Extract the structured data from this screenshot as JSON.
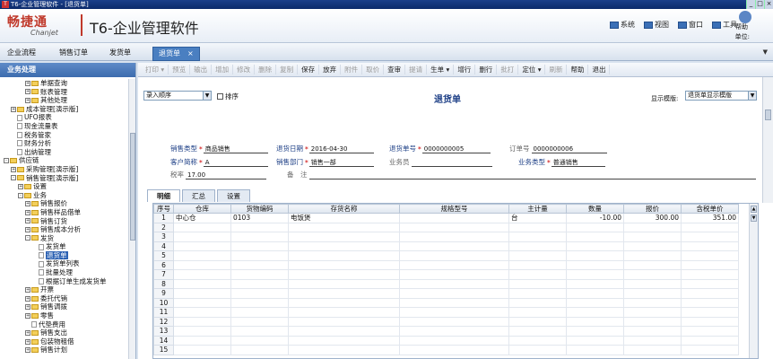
{
  "window": {
    "title": "T6-企业管理软件 - [退货单]",
    "logo_cn": "畅捷通",
    "logo_en": "Chanjet",
    "product": "T6-企业管理软件",
    "menu": [
      {
        "label": "系统",
        "icon": "monitor-icon"
      },
      {
        "label": "视图",
        "icon": "grid-icon"
      },
      {
        "label": "窗口",
        "icon": "window-icon"
      },
      {
        "label": "工具",
        "icon": "wrench-icon"
      }
    ],
    "help": "帮助",
    "position": "单位:"
  },
  "tabs": [
    {
      "label": "企业流程"
    },
    {
      "label": "销售订单"
    },
    {
      "label": "发货单"
    },
    {
      "label": "退货单",
      "active": true
    }
  ],
  "tab_close": "×",
  "sidebar": {
    "title": "业务处理",
    "tree": [
      {
        "label": "单据查询",
        "level": 3,
        "type": "folder",
        "pm": "+"
      },
      {
        "label": "账表管理",
        "level": 3,
        "type": "folder",
        "pm": "+"
      },
      {
        "label": "其他处理",
        "level": 3,
        "type": "folder",
        "pm": "+"
      },
      {
        "label": "成本管理[演示版]",
        "level": 1,
        "type": "folder",
        "pm": "+"
      },
      {
        "label": "UFO报表",
        "level": 1,
        "type": "doc",
        "pm": ""
      },
      {
        "label": "现金流量表",
        "level": 1,
        "type": "doc",
        "pm": ""
      },
      {
        "label": "税务管家",
        "level": 1,
        "type": "doc",
        "pm": ""
      },
      {
        "label": "财务分析",
        "level": 1,
        "type": "doc",
        "pm": ""
      },
      {
        "label": "出纳管理",
        "level": 1,
        "type": "doc",
        "pm": ""
      },
      {
        "label": "供应链",
        "level": 0,
        "type": "folder",
        "pm": "-"
      },
      {
        "label": "采购管理[演示版]",
        "level": 1,
        "type": "folder",
        "pm": "+"
      },
      {
        "label": "销售管理[演示版]",
        "level": 1,
        "type": "folder",
        "pm": "-"
      },
      {
        "label": "设置",
        "level": 2,
        "type": "folder",
        "pm": "+"
      },
      {
        "label": "业务",
        "level": 2,
        "type": "folder",
        "pm": "-"
      },
      {
        "label": "销售报价",
        "level": 3,
        "type": "folder",
        "pm": "+"
      },
      {
        "label": "销售样品借单",
        "level": 3,
        "type": "folder",
        "pm": "+"
      },
      {
        "label": "销售订货",
        "level": 3,
        "type": "folder",
        "pm": "+"
      },
      {
        "label": "销售成本分析",
        "level": 3,
        "type": "folder",
        "pm": "+"
      },
      {
        "label": "发货",
        "level": 3,
        "type": "folder",
        "pm": "-"
      },
      {
        "label": "发货单",
        "level": 4,
        "type": "doc",
        "pm": ""
      },
      {
        "label": "退货单",
        "level": 4,
        "type": "doc",
        "pm": "",
        "selected": true
      },
      {
        "label": "发货单列表",
        "level": 4,
        "type": "doc",
        "pm": ""
      },
      {
        "label": "批量处理",
        "level": 4,
        "type": "doc",
        "pm": ""
      },
      {
        "label": "根据订单生成发货单",
        "level": 4,
        "type": "doc",
        "pm": ""
      },
      {
        "label": "开票",
        "level": 3,
        "type": "folder",
        "pm": "+"
      },
      {
        "label": "委托代销",
        "level": 3,
        "type": "folder",
        "pm": "+"
      },
      {
        "label": "销售调拨",
        "level": 3,
        "type": "folder",
        "pm": "+"
      },
      {
        "label": "零售",
        "level": 3,
        "type": "folder",
        "pm": "+"
      },
      {
        "label": "代垫费用",
        "level": 3,
        "type": "doc",
        "pm": ""
      },
      {
        "label": "销售支出",
        "level": 3,
        "type": "folder",
        "pm": "+"
      },
      {
        "label": "包装物租借",
        "level": 3,
        "type": "folder",
        "pm": "+"
      },
      {
        "label": "销售计划",
        "level": 3,
        "type": "folder",
        "pm": "+"
      }
    ]
  },
  "toolbar": [
    {
      "label": "打印 ▾",
      "enabled": false
    },
    {
      "label": "预览",
      "enabled": false
    },
    {
      "label": "输出",
      "enabled": false
    },
    {
      "label": "增加",
      "enabled": false
    },
    {
      "label": "修改",
      "enabled": false
    },
    {
      "label": "删除",
      "enabled": false
    },
    {
      "label": "复制",
      "enabled": false
    },
    {
      "label": "保存",
      "enabled": true
    },
    {
      "label": "放弃",
      "enabled": true
    },
    {
      "label": "附件",
      "enabled": false
    },
    {
      "label": "取价",
      "enabled": false
    },
    {
      "label": "查审",
      "enabled": true
    },
    {
      "label": "提请",
      "enabled": false
    },
    {
      "label": "生单 ▾",
      "enabled": true
    },
    {
      "label": "增行",
      "enabled": true
    },
    {
      "label": "删行",
      "enabled": true
    },
    {
      "label": "批打",
      "enabled": false
    },
    {
      "label": "定位 ▾",
      "enabled": true
    },
    {
      "label": "刷新",
      "enabled": false
    },
    {
      "label": "帮助",
      "enabled": true
    },
    {
      "label": "退出",
      "enabled": true
    }
  ],
  "form": {
    "order_select": "录入顺序",
    "sort_label": "排序",
    "doc_title": "退货单",
    "template_label": "显示模版:",
    "template_value": "退货单显示模版",
    "fields": {
      "sales_type": {
        "label": "销售类型",
        "value": "商品销售"
      },
      "return_date": {
        "label": "退货日期",
        "value": "2016-04-30"
      },
      "return_no": {
        "label": "退货单号",
        "value": "0000000005"
      },
      "order_no": {
        "label": "订单号",
        "value": "0000000006"
      },
      "customer": {
        "label": "客户简称",
        "value": "A"
      },
      "dept": {
        "label": "销售部门",
        "value": "销售一部"
      },
      "salesman": {
        "label": "业务员",
        "value": ""
      },
      "biz_type": {
        "label": "业务类型",
        "value": "普通销售"
      },
      "tax_rate": {
        "label": "税率",
        "value": "17.00"
      },
      "remark": {
        "label": "备　注",
        "value": ""
      }
    }
  },
  "detail_tabs": [
    {
      "label": "明细",
      "active": true
    },
    {
      "label": "汇总"
    },
    {
      "label": "设置"
    }
  ],
  "grid": {
    "headers": [
      "序号",
      "仓库",
      "货物编码",
      "存货名称",
      "规格型号",
      "主计量",
      "数量",
      "报价",
      "含税单价"
    ],
    "rows": [
      [
        "1",
        "中心仓",
        "0103",
        "电饭煲",
        "",
        "台",
        "-10.00",
        "300.00",
        "351.00"
      ],
      [
        "2",
        "",
        "",
        "",
        "",
        "",
        "",
        "",
        ""
      ],
      [
        "3",
        "",
        "",
        "",
        "",
        "",
        "",
        "",
        ""
      ],
      [
        "4",
        "",
        "",
        "",
        "",
        "",
        "",
        "",
        ""
      ],
      [
        "5",
        "",
        "",
        "",
        "",
        "",
        "",
        "",
        ""
      ],
      [
        "6",
        "",
        "",
        "",
        "",
        "",
        "",
        "",
        ""
      ],
      [
        "7",
        "",
        "",
        "",
        "",
        "",
        "",
        "",
        ""
      ],
      [
        "8",
        "",
        "",
        "",
        "",
        "",
        "",
        "",
        ""
      ],
      [
        "9",
        "",
        "",
        "",
        "",
        "",
        "",
        "",
        ""
      ],
      [
        "10",
        "",
        "",
        "",
        "",
        "",
        "",
        "",
        ""
      ],
      [
        "11",
        "",
        "",
        "",
        "",
        "",
        "",
        "",
        ""
      ],
      [
        "12",
        "",
        "",
        "",
        "",
        "",
        "",
        "",
        ""
      ],
      [
        "13",
        "",
        "",
        "",
        "",
        "",
        "",
        "",
        ""
      ],
      [
        "14",
        "",
        "",
        "",
        "",
        "",
        "",
        "",
        ""
      ],
      [
        "15",
        "",
        "",
        "",
        "",
        "",
        "",
        "",
        ""
      ]
    ]
  },
  "colors": {
    "accent": "#2d62b3",
    "label_blue": "#1d3f86",
    "brand_red": "#c0392b"
  }
}
